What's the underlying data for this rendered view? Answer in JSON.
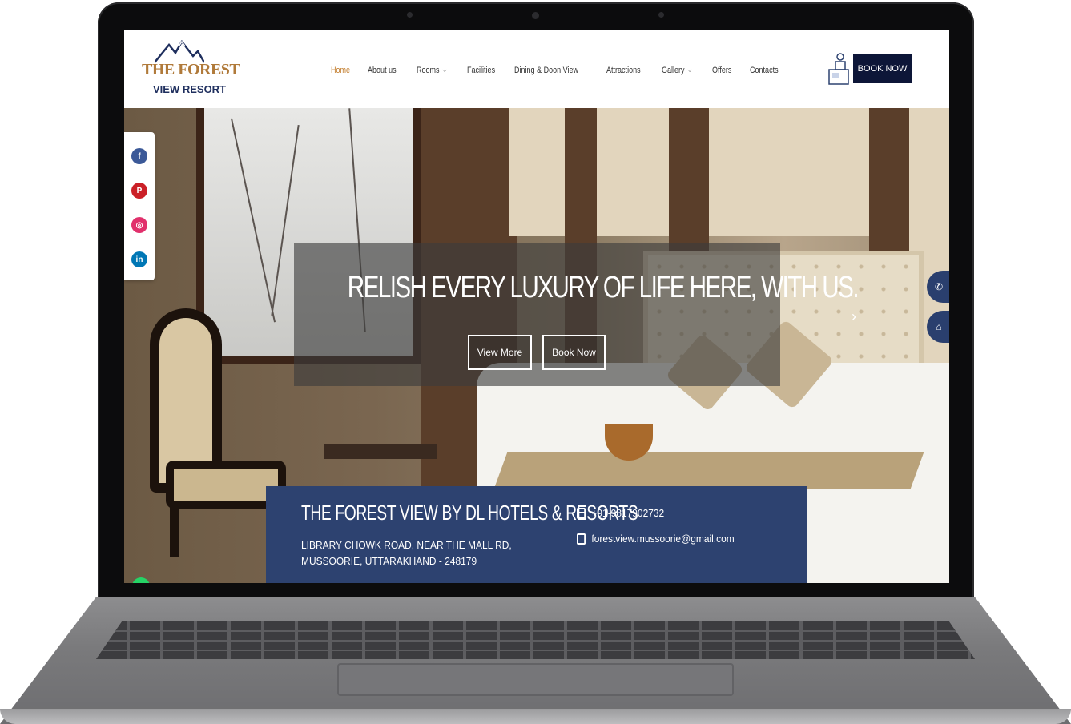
{
  "brand": {
    "logo_line1": "THE FOREST",
    "logo_line2": "VIEW RESORT"
  },
  "nav": {
    "items": [
      {
        "label": "Home",
        "active": true,
        "dropdown": false
      },
      {
        "label": "About us",
        "active": false,
        "dropdown": false
      },
      {
        "label": "Rooms",
        "active": false,
        "dropdown": true
      },
      {
        "label": "Facilities",
        "active": false,
        "dropdown": false
      },
      {
        "label": "Dining & Doon View",
        "active": false,
        "dropdown": false
      },
      {
        "label": "Attractions",
        "active": false,
        "dropdown": false
      },
      {
        "label": "Gallery",
        "active": false,
        "dropdown": true
      },
      {
        "label": "Offers",
        "active": false,
        "dropdown": false
      },
      {
        "label": "Contacts",
        "active": false,
        "dropdown": false
      }
    ],
    "book_now": "BOOK NOW"
  },
  "hero": {
    "title": "RELISH EVERY LUXURY OF LIFE HERE, WITH US.",
    "view_more": "View More",
    "book_now": "Book Now"
  },
  "social": [
    {
      "name": "facebook-icon",
      "glyph": "f",
      "color": "#3b5998"
    },
    {
      "name": "pinterest-icon",
      "glyph": "P",
      "color": "#cb2027"
    },
    {
      "name": "instagram-icon",
      "glyph": "◎",
      "color": "#e1306c"
    },
    {
      "name": "linkedin-icon",
      "glyph": "in",
      "color": "#0077b5"
    }
  ],
  "info": {
    "title": "THE FOREST VIEW BY DL HOTELS & RESORTS",
    "address": "LIBRARY CHOWK ROAD, NEAR THE MALL RD, MUSSOORIE, UTTARAKHAND - 248179",
    "phone": "+91-9817902732",
    "email": "forestview.mussoorie@gmail.com"
  },
  "colors": {
    "nav_active": "#c27c2b",
    "book_button": "#0d1638",
    "info_card": "#2d4270"
  }
}
